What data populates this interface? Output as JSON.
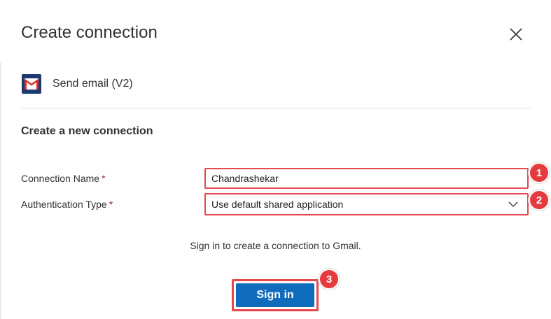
{
  "dialog": {
    "title": "Create connection"
  },
  "action": {
    "label": "Send email (V2)",
    "icon": "gmail-icon"
  },
  "section": {
    "title": "Create a new connection"
  },
  "fields": {
    "connection_name": {
      "label": "Connection Name",
      "required_marker": "*",
      "value": "Chandrashekar"
    },
    "auth_type": {
      "label": "Authentication Type",
      "required_marker": "*",
      "value": "Use default shared application"
    }
  },
  "info": {
    "text": "Sign in to create a connection to Gmail."
  },
  "buttons": {
    "sign_in": "Sign in"
  },
  "annotations": {
    "badge_1": "1",
    "badge_2": "2",
    "badge_3": "3"
  },
  "colors": {
    "accent": "#0f6cbd",
    "highlight": "#e8474f",
    "required": "#a4262c",
    "gmail_tile": "#1d3a70"
  }
}
